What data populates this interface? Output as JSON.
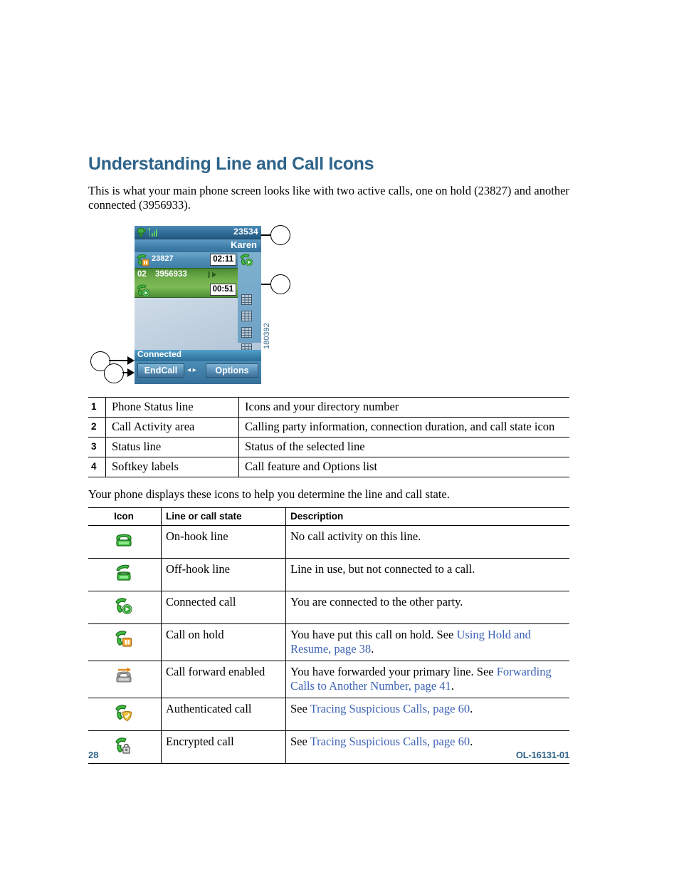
{
  "heading": "Understanding Line and Call Icons",
  "intro": "This is what your main phone screen looks like with two active calls, one on hold (23827) and another connected (3956933).",
  "figure": {
    "id_label": "180392",
    "phone_screen": {
      "directory_number": "23534",
      "caller_name": "Karen",
      "call1": {
        "number": "23827",
        "duration": "02:11"
      },
      "call2": {
        "line_id": "02",
        "number": "3956933",
        "duration": "00:51"
      },
      "status_line": "Connected",
      "softkey_left": "EndCall",
      "softkey_right": "Options",
      "nav_arrows": "◂ ▸"
    },
    "callouts": [
      "",
      "",
      "",
      ""
    ]
  },
  "table1": {
    "rows": [
      {
        "num": "1",
        "label": "Phone Status line",
        "desc": "Icons and your directory number"
      },
      {
        "num": "2",
        "label": "Call Activity area",
        "desc": "Calling party information, connection duration, and call state icon"
      },
      {
        "num": "3",
        "label": "Status line",
        "desc": "Status of the selected line"
      },
      {
        "num": "4",
        "label": "Softkey labels",
        "desc": "Call feature and Options list"
      }
    ]
  },
  "lead2": "Your phone displays these icons to help you determine the line and call state.",
  "table2": {
    "headers": [
      "Icon",
      "Line or call state",
      "Description"
    ],
    "rows": [
      {
        "icon": "on-hook-phone-icon",
        "state": "On-hook line",
        "desc_pre": "No call activity on this line.",
        "desc_link": "",
        "desc_post": ""
      },
      {
        "icon": "off-hook-phone-icon",
        "state": "Off-hook line",
        "desc_pre": "Line in use, but not connected to a call.",
        "desc_link": "",
        "desc_post": ""
      },
      {
        "icon": "connected-call-icon",
        "state": "Connected call",
        "desc_pre": "You are connected to the other party.",
        "desc_link": "",
        "desc_post": ""
      },
      {
        "icon": "call-on-hold-icon",
        "state": "Call on hold",
        "desc_pre": "You have put this call on hold. See ",
        "desc_link": "Using Hold and Resume, page 38",
        "desc_post": "."
      },
      {
        "icon": "call-forward-icon",
        "state": "Call forward enabled",
        "desc_pre": "You have forwarded your primary line. See ",
        "desc_link": "Forwarding Calls to Another Number, page 41",
        "desc_post": "."
      },
      {
        "icon": "authenticated-call-icon",
        "state": "Authenticated call",
        "desc_pre": "See ",
        "desc_link": "Tracing Suspicious Calls, page 60",
        "desc_post": "."
      },
      {
        "icon": "encrypted-call-icon",
        "state": "Encrypted call",
        "desc_pre": "See ",
        "desc_link": "Tracing Suspicious Calls, page 60",
        "desc_post": "."
      }
    ]
  },
  "footer": {
    "page_number": "28",
    "doc_id": "OL-16131-01"
  },
  "colors": {
    "heading": "#2e6389",
    "link": "#3d62b4",
    "screen_blue": "#3e7ea8",
    "selected_green": "#6fae4b"
  }
}
